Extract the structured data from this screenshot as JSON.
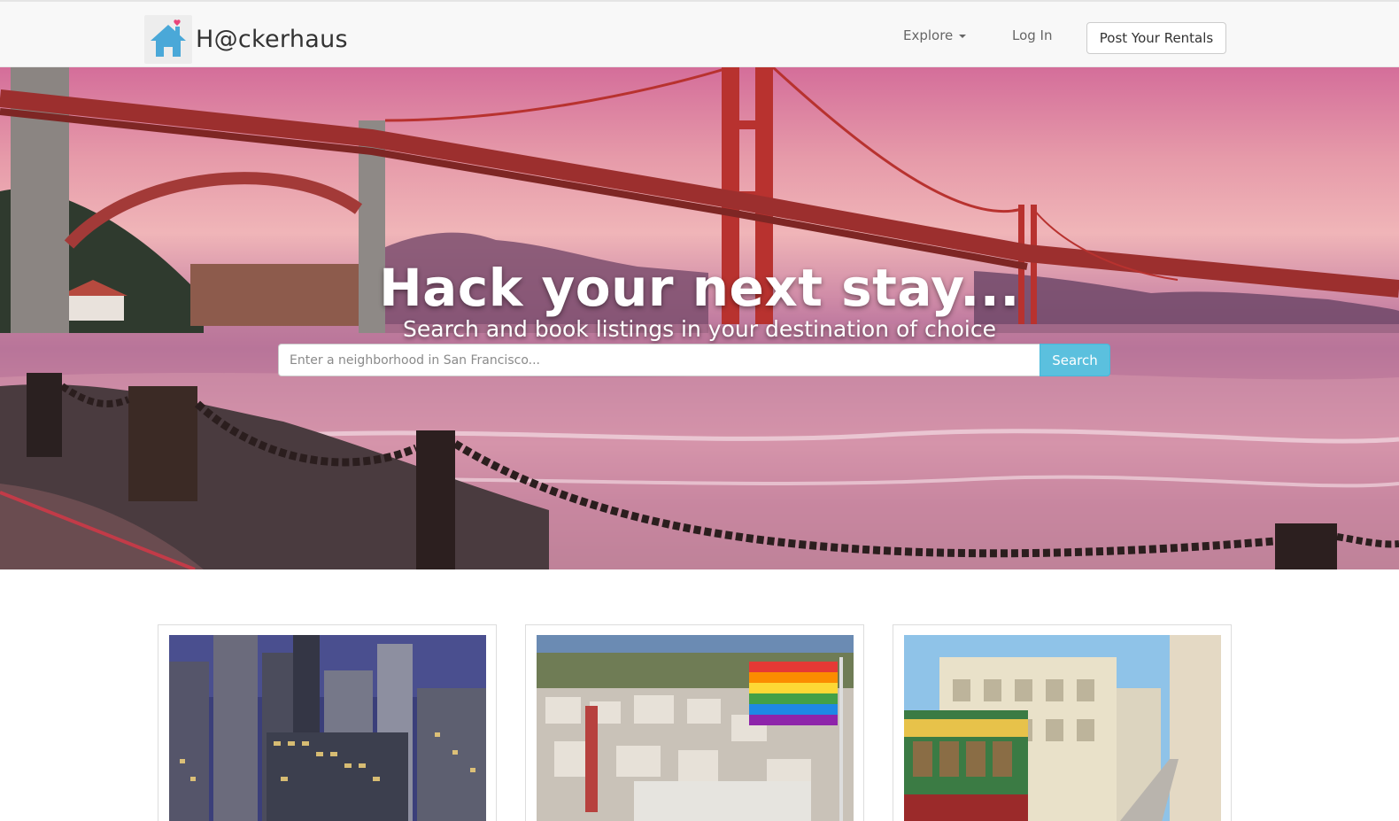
{
  "navbar": {
    "brand": "H@ckerhaus",
    "explore_label": "Explore",
    "login_label": "Log In",
    "post_label": "Post Your Rentals"
  },
  "hero": {
    "title": "Hack your next stay...",
    "subtitle": "Search and book listings in your destination of choice",
    "search_placeholder": "Enter a neighborhood in San Francisco...",
    "search_button": "Search"
  },
  "neighborhoods": [
    {
      "image": "downtown-skyline-photo"
    },
    {
      "image": "castro-rainbow-flag-photo"
    },
    {
      "image": "cable-car-street-photo"
    }
  ],
  "colors": {
    "accent": "#5bc0de",
    "brand_house": "#4aa8d8",
    "brand_heart": "#e8457a",
    "bridge": "#b8322f"
  },
  "icons": {
    "brand": "house-heart-icon",
    "explore_caret": "caret-down-icon"
  }
}
